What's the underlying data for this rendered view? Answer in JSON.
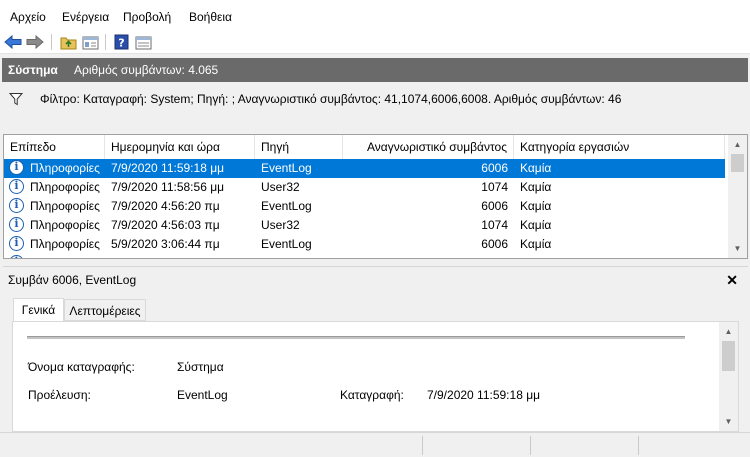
{
  "menu": {
    "items": [
      "Αρχείο",
      "Ενέργεια",
      "Προβολή",
      "Βοήθεια"
    ]
  },
  "toolbar": {
    "icons": [
      "back-arrow-icon",
      "forward-arrow-icon",
      "folder-up-icon",
      "show-hide-pane-icon",
      "help-icon",
      "properties-pane-icon"
    ]
  },
  "header": {
    "title": "Σύστημα",
    "count_text": "Αριθμός συμβάντων: 4.065"
  },
  "filter": {
    "text": "Φίλτρο: Καταγραφή: System; Πηγή: ; Αναγνωριστικό συμβάντος: 41,1074,6006,6008. Αριθμός συμβάντων: 46"
  },
  "event_list": {
    "columns": [
      "Επίπεδο",
      "Ημερομηνία και ώρα",
      "Πηγή",
      "Αναγνωριστικό συμβάντος",
      "Κατηγορία εργασιών"
    ],
    "rows": [
      {
        "level": "Πληροφορίες",
        "datetime": "7/9/2020 11:59:18 μμ",
        "source": "EventLog",
        "id": "6006",
        "category": "Καμία",
        "selected": true
      },
      {
        "level": "Πληροφορίες",
        "datetime": "7/9/2020 11:58:56 μμ",
        "source": "User32",
        "id": "1074",
        "category": "Καμία",
        "selected": false
      },
      {
        "level": "Πληροφορίες",
        "datetime": "7/9/2020 4:56:20 πμ",
        "source": "EventLog",
        "id": "6006",
        "category": "Καμία",
        "selected": false
      },
      {
        "level": "Πληροφορίες",
        "datetime": "7/9/2020 4:56:03 πμ",
        "source": "User32",
        "id": "1074",
        "category": "Καμία",
        "selected": false
      },
      {
        "level": "Πληροφορίες",
        "datetime": "5/9/2020 3:06:44 πμ",
        "source": "EventLog",
        "id": "6006",
        "category": "Καμία",
        "selected": false
      }
    ]
  },
  "details": {
    "title": "Συμβάν 6006, EventLog",
    "close_glyph": "✕",
    "tabs": [
      "Γενικά",
      "Λεπτομέρειες"
    ],
    "fields": {
      "log_name_label": "Όνομα καταγραφής:",
      "log_name_value": "Σύστημα",
      "source_label": "Προέλευση:",
      "source_value": "EventLog",
      "logged_label": "Καταγραφή:",
      "logged_value": "7/9/2020 11:59:18 μμ"
    }
  },
  "colors": {
    "selection": "#0078d7",
    "header_bar": "#6a6a6a",
    "info_icon": "#1e5fb4"
  }
}
